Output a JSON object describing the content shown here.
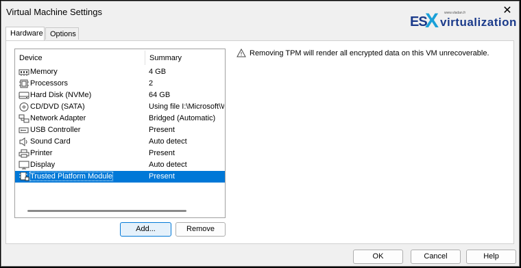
{
  "window": {
    "title": "Virtual Machine Settings"
  },
  "logo": {
    "prefix": "ES",
    "x": "X",
    "name": "virtualization",
    "small": "www.vladan.fr"
  },
  "tabs": [
    {
      "label": "Hardware",
      "active": true
    },
    {
      "label": "Options",
      "active": false
    }
  ],
  "device_list": {
    "headers": {
      "device": "Device",
      "summary": "Summary"
    },
    "rows": [
      {
        "device": "Memory",
        "summary": "4 GB",
        "icon": "memory-icon"
      },
      {
        "device": "Processors",
        "summary": "2",
        "icon": "processor-icon"
      },
      {
        "device": "Hard Disk (NVMe)",
        "summary": "64 GB",
        "icon": "hard-disk-icon"
      },
      {
        "device": "CD/DVD (SATA)",
        "summary": "Using file I:\\Microsoft\\W",
        "icon": "cd-dvd-icon"
      },
      {
        "device": "Network Adapter",
        "summary": "Bridged (Automatic)",
        "icon": "network-adapter-icon"
      },
      {
        "device": "USB Controller",
        "summary": "Present",
        "icon": "usb-icon"
      },
      {
        "device": "Sound Card",
        "summary": "Auto detect",
        "icon": "speaker-icon"
      },
      {
        "device": "Printer",
        "summary": "Present",
        "icon": "printer-icon"
      },
      {
        "device": "Display",
        "summary": "Auto detect",
        "icon": "monitor-icon"
      },
      {
        "device": "Trusted Platform Module",
        "summary": "Present",
        "icon": "tpm-chip-icon",
        "selected": true
      }
    ]
  },
  "buttons": {
    "add": "Add...",
    "remove": "Remove",
    "ok": "OK",
    "cancel": "Cancel",
    "help": "Help"
  },
  "warning": {
    "text": "Removing TPM will render all encrypted data on this VM unrecoverable.",
    "icon": "warning-icon"
  },
  "colors": {
    "selection": "#0078d7",
    "logo_dark": "#1a3a8a",
    "logo_light": "#1aa0d8"
  }
}
